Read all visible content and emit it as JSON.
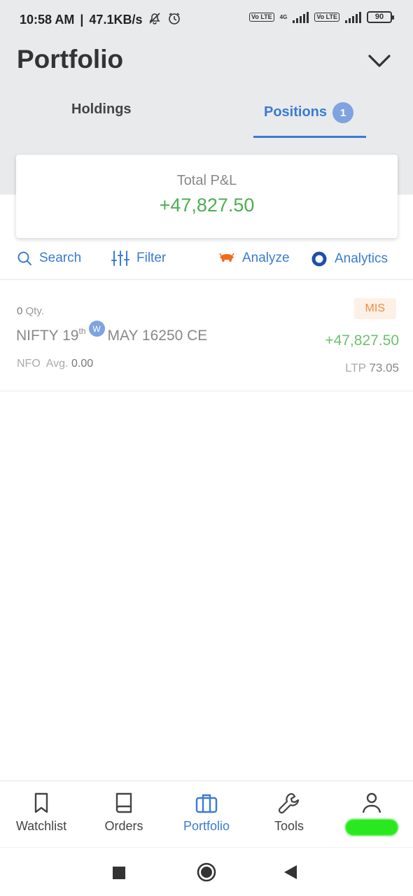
{
  "status_bar": {
    "time": "10:58 AM",
    "separator": "|",
    "net_speed": "47.1KB/s",
    "volte1": "Vo LTE",
    "net_type": "4G",
    "volte2": "Vo LTE",
    "battery": "90"
  },
  "header": {
    "title": "Portfolio"
  },
  "tabs": {
    "holdings": "Holdings",
    "positions": "Positions",
    "positions_count": "1"
  },
  "pnl_card": {
    "label": "Total P&L",
    "value": "+47,827.50"
  },
  "toolbar": {
    "search": "Search",
    "filter": "Filter",
    "analyze": "Analyze",
    "analytics": "Analytics"
  },
  "positions": [
    {
      "qty_value": "0",
      "qty_unit": "Qty.",
      "product": "MIS",
      "symbol": "NIFTY 19",
      "day_suffix": "th",
      "weekly_badge": "W",
      "contract": "MAY 16250 CE",
      "pnl": "+47,827.50",
      "exchange": "NFO",
      "avg_label": "Avg.",
      "avg_value": "0.00",
      "ltp_label": "LTP",
      "ltp_value": "73.05"
    }
  ],
  "bottom_nav": {
    "watchlist": "Watchlist",
    "orders": "Orders",
    "portfolio": "Portfolio",
    "tools": "Tools"
  },
  "colors": {
    "accent": "#3a7bd5",
    "profit": "#4caf50",
    "mis": "#f08c3c",
    "header_bg": "#e9eaec"
  }
}
